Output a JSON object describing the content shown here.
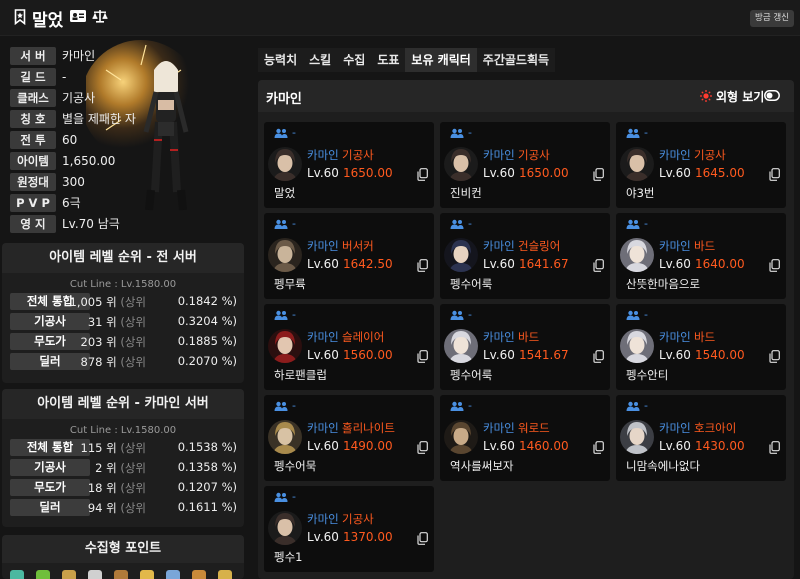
{
  "header": {
    "character_name": "말었",
    "refresh_label": "방금 갱신"
  },
  "profile": {
    "rows": [
      {
        "label": "서 버",
        "value": "카마인"
      },
      {
        "label": "길 드",
        "value": "-"
      },
      {
        "label": "클래스",
        "value": "기공사"
      },
      {
        "label": "칭 호",
        "value": "별을 제패한 자"
      },
      {
        "label": "전 투",
        "value": "60"
      },
      {
        "label": "아이템",
        "value": "1,650.00"
      },
      {
        "label": "원정대",
        "value": "300"
      },
      {
        "label": "P V P",
        "value": "6극"
      },
      {
        "label": "영 지",
        "value": "Lv.70 남극"
      }
    ]
  },
  "rank_all": {
    "title": "아이템 레벨 순위 - 전 서버",
    "cutline": "Cut Line : Lv.1580.00",
    "rows": [
      {
        "label": "전체 통합",
        "rank": "1,005 위",
        "upper": "(상위",
        "pct": "0.1842 %)"
      },
      {
        "label": "기공사",
        "rank": "31 위",
        "upper": "(상위",
        "pct": "0.3204 %)"
      },
      {
        "label": "무도가",
        "rank": "203 위",
        "upper": "(상위",
        "pct": "0.1885 %)"
      },
      {
        "label": "딜러",
        "rank": "878 위",
        "upper": "(상위",
        "pct": "0.2070 %)"
      }
    ]
  },
  "rank_server": {
    "title": "아이템 레벨 순위 - 카마인 서버",
    "cutline": "Cut Line : Lv.1580.00",
    "rows": [
      {
        "label": "전체 통합",
        "rank": "115 위",
        "upper": "(상위",
        "pct": "0.1538 %)"
      },
      {
        "label": "기공사",
        "rank": "2 위",
        "upper": "(상위",
        "pct": "0.1358 %)"
      },
      {
        "label": "무도가",
        "rank": "18 위",
        "upper": "(상위",
        "pct": "0.1207 %)"
      },
      {
        "label": "딜러",
        "rank": "94 위",
        "upper": "(상위",
        "pct": "0.1611 %)"
      }
    ]
  },
  "collect": {
    "title": "수집형 포인트"
  },
  "tabs": [
    "능력치",
    "스킬",
    "수집",
    "도표",
    "보유 캐릭터",
    "주간골드획득"
  ],
  "active_tab": "보유 캐릭터",
  "panel": {
    "server": "카마인",
    "appearance_label": "외형 보기"
  },
  "characters": [
    {
      "guild": "-",
      "server": "카마인",
      "class": "기공사",
      "level": "Lv.60",
      "item_level": "1650.00",
      "name": "말었",
      "avatar": "female-dark"
    },
    {
      "guild": "-",
      "server": "카마인",
      "class": "기공사",
      "level": "Lv.60",
      "item_level": "1650.00",
      "name": "진비컨",
      "avatar": "female-dark"
    },
    {
      "guild": "-",
      "server": "카마인",
      "class": "기공사",
      "level": "Lv.60",
      "item_level": "1645.00",
      "name": "야3번",
      "avatar": "female-dark"
    },
    {
      "guild": "-",
      "server": "카마인",
      "class": "버서커",
      "level": "Lv.60",
      "item_level": "1642.50",
      "name": "펭무륙",
      "avatar": "male-berserker"
    },
    {
      "guild": "-",
      "server": "카마인",
      "class": "건슬링어",
      "level": "Lv.60",
      "item_level": "1641.67",
      "name": "펭수어룩",
      "avatar": "female-gunslinger"
    },
    {
      "guild": "-",
      "server": "카마인",
      "class": "바드",
      "level": "Lv.60",
      "item_level": "1640.00",
      "name": "산뜻한마음으로",
      "avatar": "female-bard"
    },
    {
      "guild": "-",
      "server": "카마인",
      "class": "슬레이어",
      "level": "Lv.60",
      "item_level": "1560.00",
      "name": "하로팬클럽",
      "avatar": "female-slayer"
    },
    {
      "guild": "-",
      "server": "카마인",
      "class": "바드",
      "level": "Lv.60",
      "item_level": "1541.67",
      "name": "펭수어룩",
      "avatar": "female-bard"
    },
    {
      "guild": "-",
      "server": "카마인",
      "class": "바드",
      "level": "Lv.60",
      "item_level": "1540.00",
      "name": "펭수안티",
      "avatar": "female-bard"
    },
    {
      "guild": "-",
      "server": "카마인",
      "class": "홀리나이트",
      "level": "Lv.60",
      "item_level": "1490.00",
      "name": "펭수어묵",
      "avatar": "male-paladin"
    },
    {
      "guild": "-",
      "server": "카마인",
      "class": "워로드",
      "level": "Lv.60",
      "item_level": "1460.00",
      "name": "역사를써보자",
      "avatar": "male-warlord"
    },
    {
      "guild": "-",
      "server": "카마인",
      "class": "호크아이",
      "level": "Lv.60",
      "item_level": "1430.00",
      "name": "니맘속에나없다",
      "avatar": "female-hawkeye"
    },
    {
      "guild": "-",
      "server": "카마인",
      "class": "기공사",
      "level": "Lv.60",
      "item_level": "1370.00",
      "name": "펭수1",
      "avatar": "female-dark"
    }
  ],
  "colors": {
    "accent_blue": "#4a90e2",
    "accent_orange": "#ff5a1f"
  }
}
